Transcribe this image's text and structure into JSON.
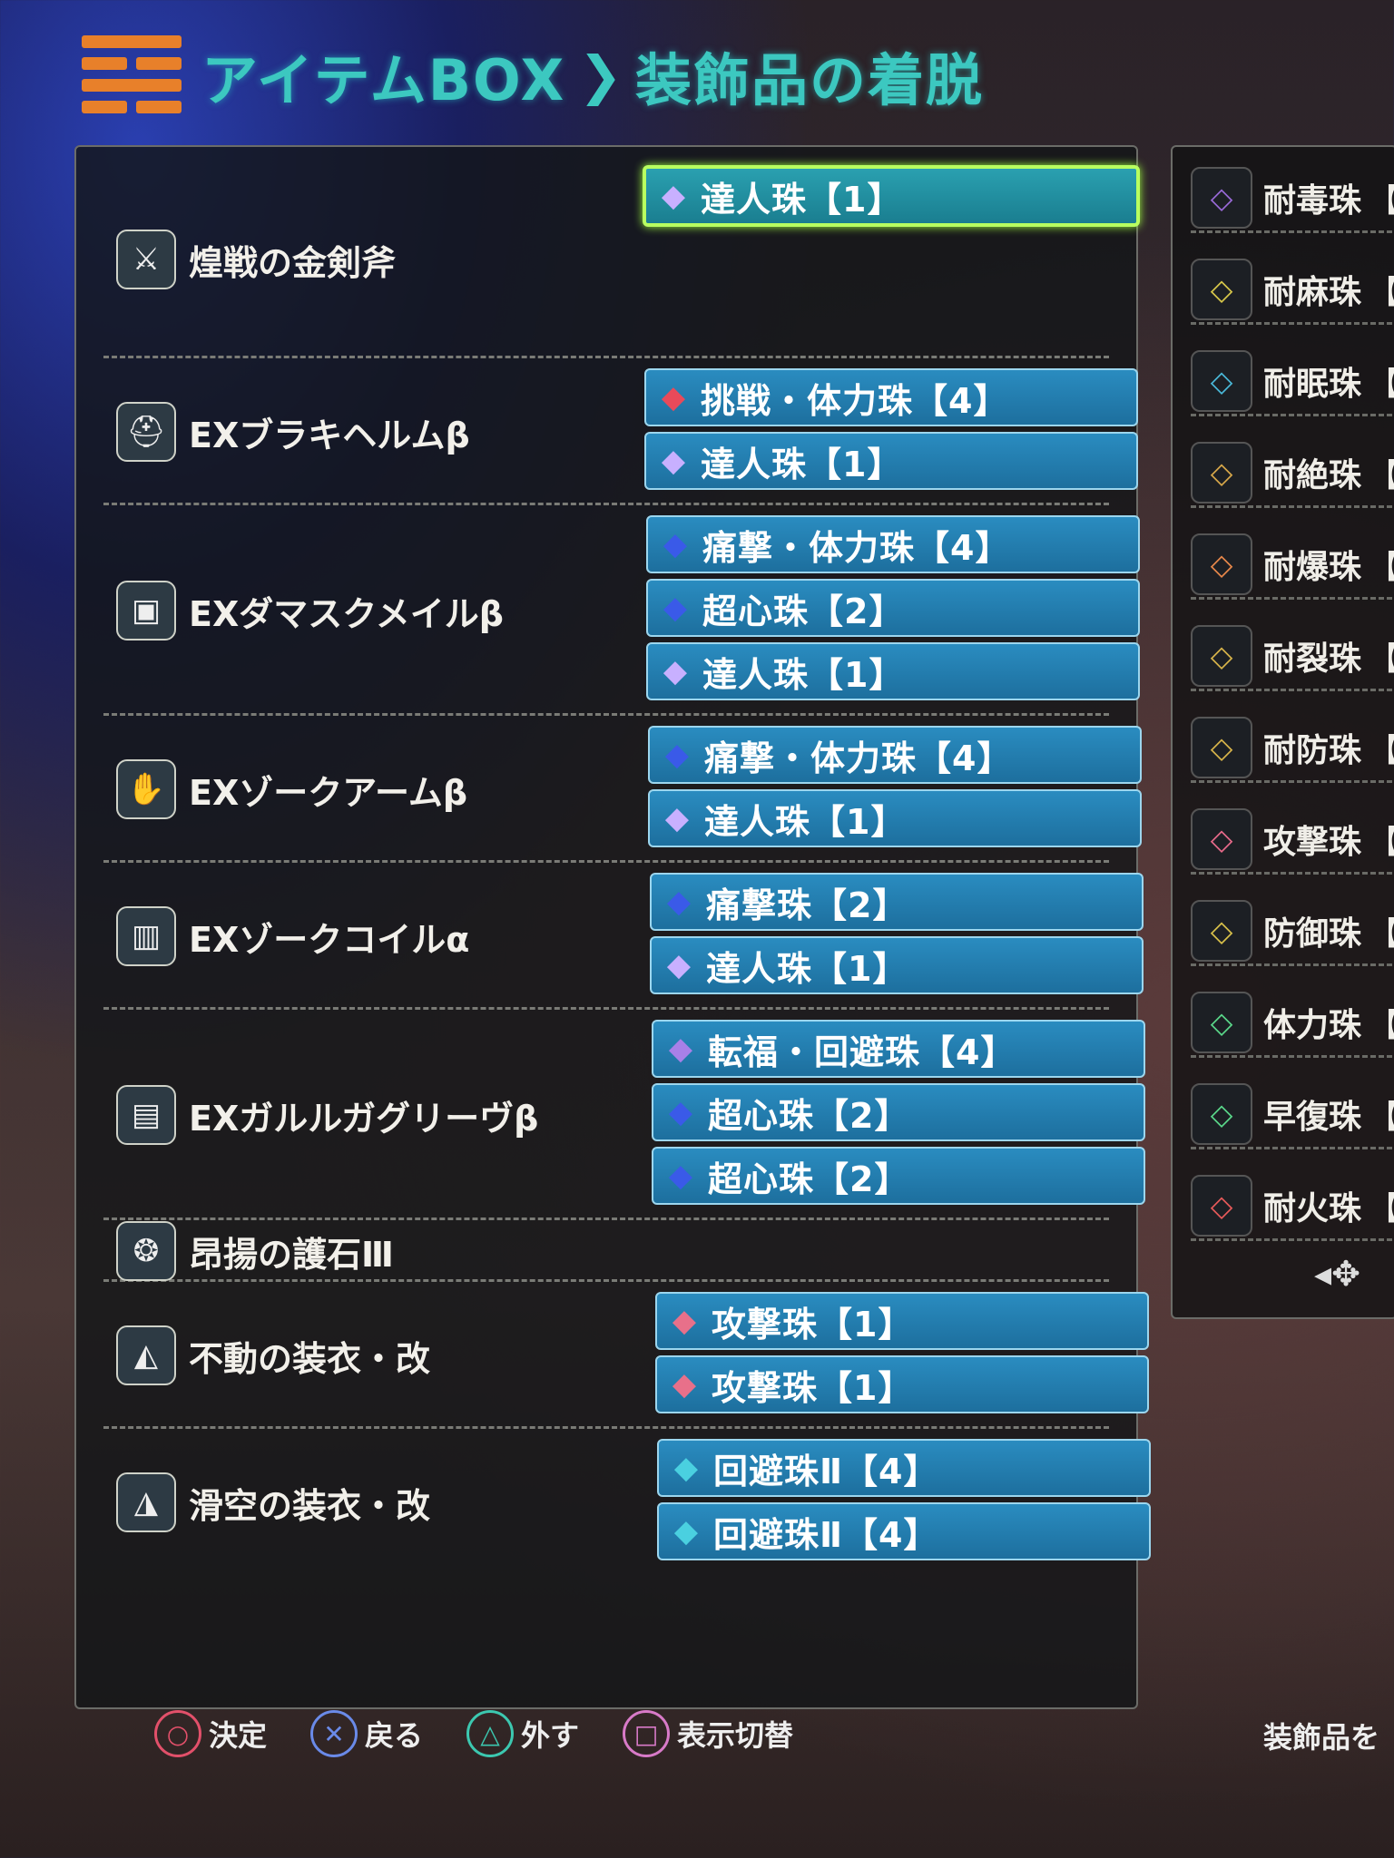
{
  "header": {
    "crumb1": "アイテムBOX",
    "sep": "❯",
    "crumb2": "装飾品の着脱"
  },
  "equipment": [
    {
      "name": "煌戦の金剣斧",
      "icon": "sword-axe-icon",
      "gems": [
        "達人珠【1】"
      ]
    },
    {
      "name": "EXブラキヘルムβ",
      "icon": "helm-icon",
      "gems": [
        "挑戦・体力珠【4】",
        "達人珠【1】"
      ]
    },
    {
      "name": "EXダマスクメイルβ",
      "icon": "chest-icon",
      "gems": [
        "痛撃・体力珠【4】",
        "超心珠【2】",
        "達人珠【1】"
      ]
    },
    {
      "name": "EXゾークアームβ",
      "icon": "arm-icon",
      "gems": [
        "痛撃・体力珠【4】",
        "達人珠【1】"
      ]
    },
    {
      "name": "EXゾークコイルα",
      "icon": "waist-icon",
      "gems": [
        "痛撃珠【2】",
        "達人珠【1】"
      ]
    },
    {
      "name": "EXガルルガグリーヴβ",
      "icon": "legs-icon",
      "gems": [
        "転福・回避珠【4】",
        "超心珠【2】",
        "超心珠【2】"
      ]
    },
    {
      "name": "昂揚の護石Ⅲ",
      "icon": "charm-icon",
      "gems": []
    },
    {
      "name": "不動の装衣・改",
      "icon": "mantle-icon",
      "gems": [
        "攻撃珠【1】",
        "攻撃珠【1】"
      ]
    },
    {
      "name": "滑空の装衣・改",
      "icon": "glider-mantle-icon",
      "gems": [
        "回避珠Ⅱ【4】",
        "回避珠Ⅱ【4】"
      ]
    }
  ],
  "decorations": [
    {
      "name": "耐毒珠",
      "bracket": "【",
      "color": "#9a6ad8"
    },
    {
      "name": "耐麻珠",
      "bracket": "【",
      "color": "#d8c84a"
    },
    {
      "name": "耐眠珠",
      "bracket": "【",
      "color": "#4ab8d8"
    },
    {
      "name": "耐絶珠",
      "bracket": "【",
      "color": "#d8a84a"
    },
    {
      "name": "耐爆珠",
      "bracket": "【",
      "color": "#e8884a"
    },
    {
      "name": "耐裂珠",
      "bracket": "【",
      "color": "#d8b44a"
    },
    {
      "name": "耐防珠",
      "bracket": "【",
      "color": "#d8b44a"
    },
    {
      "name": "攻撃珠",
      "bracket": "【",
      "color": "#e86a8a"
    },
    {
      "name": "防御珠",
      "bracket": "【",
      "color": "#d8c04a"
    },
    {
      "name": "体力珠",
      "bracket": "【",
      "color": "#5ad88a"
    },
    {
      "name": "早復珠",
      "bracket": "【",
      "color": "#5ad88a"
    },
    {
      "name": "耐火珠",
      "bracket": "【",
      "color": "#e85a5a"
    }
  ],
  "footer": {
    "confirm": "決定",
    "back": "戻る",
    "remove": "外す",
    "toggle": "表示切替",
    "right_text": "装飾品を"
  }
}
